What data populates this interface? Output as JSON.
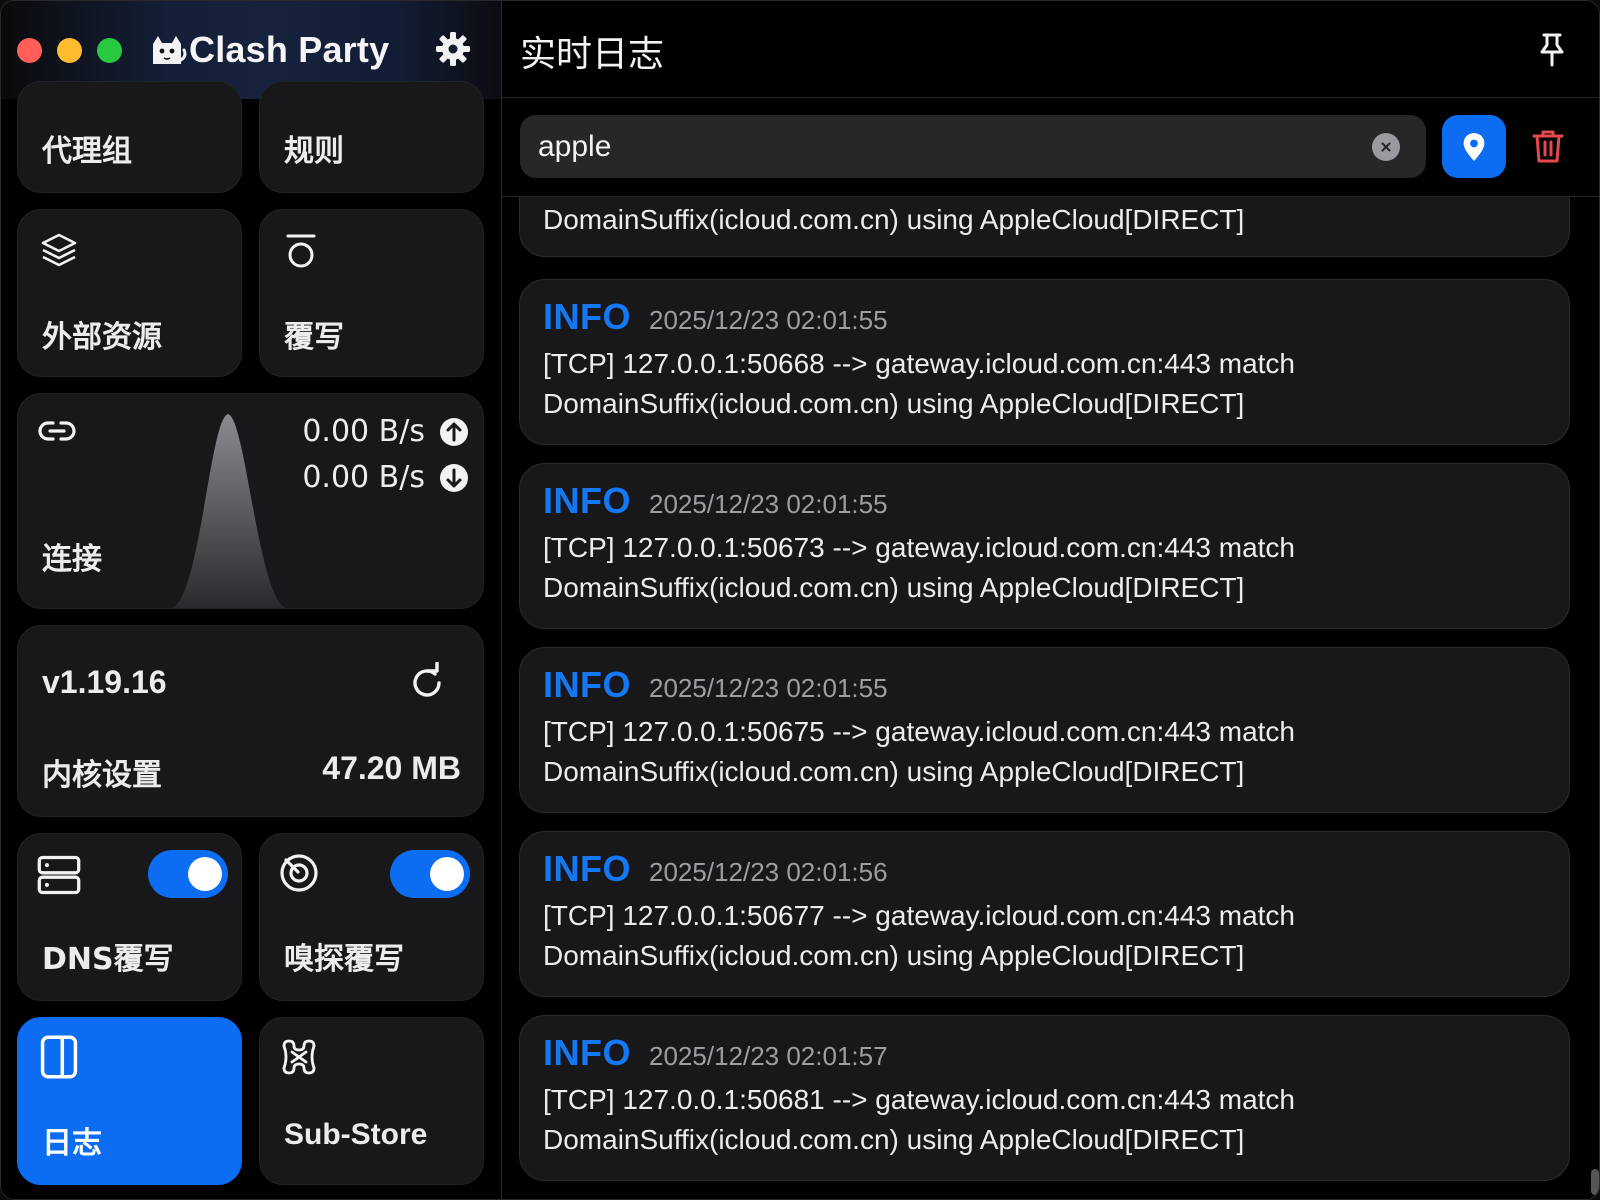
{
  "app": {
    "name": "Clash Party"
  },
  "sidebar": {
    "cards": {
      "proxy_group": {
        "label": "代理组"
      },
      "rules": {
        "label": "规则"
      },
      "external_resources": {
        "label": "外部资源"
      },
      "override": {
        "label": "覆写"
      },
      "connections": {
        "label": "连接",
        "upload_speed": "0.00 B/s",
        "download_speed": "0.00 B/s"
      },
      "core": {
        "version": "v1.19.16",
        "label": "内核设置",
        "memory": "47.20 MB"
      },
      "dns_override": {
        "label": "DNS覆写",
        "enabled": true
      },
      "sniff_override": {
        "label": "嗅探覆写",
        "enabled": true
      },
      "logs": {
        "label": "日志",
        "active": true
      },
      "sub_store": {
        "label": "Sub-Store"
      }
    }
  },
  "main": {
    "title": "实时日志",
    "search": {
      "value": "apple"
    },
    "partial_entry": {
      "text": "DomainSuffix(icloud.com.cn) using AppleCloud[DIRECT]"
    },
    "logs": [
      {
        "level": "INFO",
        "time": "2025/12/23 02:01:55",
        "line1": "[TCP] 127.0.0.1:50668 --> gateway.icloud.com.cn:443 match",
        "line2": "DomainSuffix(icloud.com.cn) using AppleCloud[DIRECT]"
      },
      {
        "level": "INFO",
        "time": "2025/12/23 02:01:55",
        "line1": "[TCP] 127.0.0.1:50673 --> gateway.icloud.com.cn:443 match",
        "line2": "DomainSuffix(icloud.com.cn) using AppleCloud[DIRECT]"
      },
      {
        "level": "INFO",
        "time": "2025/12/23 02:01:55",
        "line1": "[TCP] 127.0.0.1:50675 --> gateway.icloud.com.cn:443 match",
        "line2": "DomainSuffix(icloud.com.cn) using AppleCloud[DIRECT]"
      },
      {
        "level": "INFO",
        "time": "2025/12/23 02:01:56",
        "line1": "[TCP] 127.0.0.1:50677 --> gateway.icloud.com.cn:443 match",
        "line2": "DomainSuffix(icloud.com.cn) using AppleCloud[DIRECT]"
      },
      {
        "level": "INFO",
        "time": "2025/12/23 02:01:57",
        "line1": "[TCP] 127.0.0.1:50681 --> gateway.icloud.com.cn:443 match",
        "line2": "DomainSuffix(icloud.com.cn) using AppleCloud[DIRECT]"
      }
    ]
  },
  "colors": {
    "accent": "#0c6df2",
    "log_level_info": "#1677f2",
    "trash": "#e5484d",
    "card_bg": "#18181b"
  }
}
